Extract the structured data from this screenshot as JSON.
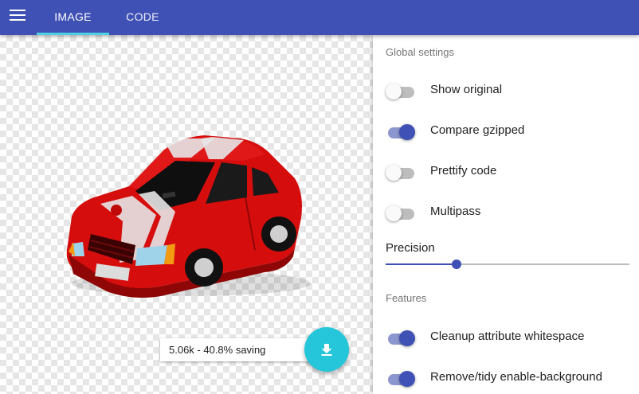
{
  "appbar": {
    "menu_icon": "hamburger-menu-icon",
    "tabs": [
      {
        "label": "IMAGE",
        "active": true
      },
      {
        "label": "CODE",
        "active": false
      }
    ],
    "accent": "#3f51b5",
    "indicator_color": "#4dd0e1"
  },
  "preview": {
    "image_description_icon": "red-car-illustration",
    "size_info": "5.06k - 40.8% saving",
    "download_icon": "download-icon",
    "fab_color": "#26c6da"
  },
  "settings": {
    "global_title": "Global settings",
    "global_toggles": [
      {
        "label": "Show original",
        "on": false
      },
      {
        "label": "Compare gzipped",
        "on": true
      },
      {
        "label": "Prettify code",
        "on": false
      },
      {
        "label": "Multipass",
        "on": false
      }
    ],
    "precision_label": "Precision",
    "precision_fraction": 0.29,
    "features_title": "Features",
    "feature_toggles": [
      {
        "label": "Cleanup attribute whitespace",
        "on": true
      },
      {
        "label": "Remove/tidy enable-background",
        "on": true
      }
    ]
  }
}
